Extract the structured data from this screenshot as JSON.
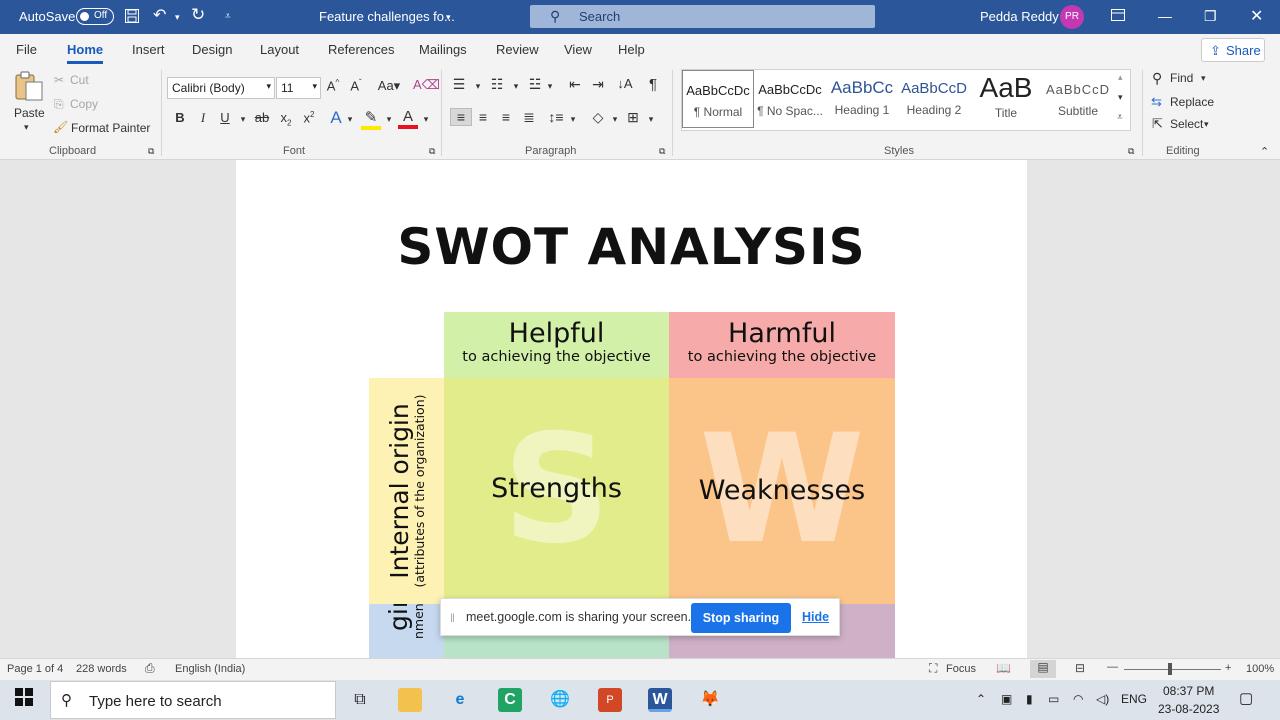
{
  "titlebar": {
    "autosave_label": "AutoSave",
    "autosave_state": "Off",
    "doc_title": "Feature challenges fo...",
    "search_placeholder": "Search",
    "user_name": "Pedda Reddy",
    "user_initials": "PR"
  },
  "menu": {
    "tabs": [
      "File",
      "Home",
      "Insert",
      "Design",
      "Layout",
      "References",
      "Mailings",
      "Review",
      "View",
      "Help"
    ],
    "active": "Home",
    "share_label": "Share"
  },
  "ribbon": {
    "clipboard": {
      "paste": "Paste",
      "cut": "Cut",
      "copy": "Copy",
      "format_painter": "Format Painter",
      "label": "Clipboard"
    },
    "font": {
      "name": "Calibri (Body)",
      "size": "11",
      "label": "Font"
    },
    "paragraph": {
      "label": "Paragraph"
    },
    "styles": {
      "items": [
        {
          "preview": "AaBbCcDc",
          "name": "¶ Normal"
        },
        {
          "preview": "AaBbCcDc",
          "name": "¶ No Spac..."
        },
        {
          "preview": "AaBbCc",
          "name": "Heading 1"
        },
        {
          "preview": "AaBbCcD",
          "name": "Heading 2"
        },
        {
          "preview": "AaB",
          "name": "Title"
        },
        {
          "preview": "AaBbCcD",
          "name": "Subtitle"
        }
      ],
      "label": "Styles"
    },
    "editing": {
      "find": "Find",
      "replace": "Replace",
      "select": "Select",
      "label": "Editing"
    }
  },
  "document": {
    "title": "SWOT ANALYSIS",
    "helpful": "Helpful",
    "helpful_sub": "to achieving the objective",
    "harmful": "Harmful",
    "harmful_sub": "to achieving the objective",
    "internal": "Internal origin",
    "internal_sub": "(attributes of the organization)",
    "external_partial": "gin",
    "external_sub_partial": "nment)",
    "strengths": "Strengths",
    "weaknesses": "Weaknesses",
    "s_letter": "S",
    "w_letter": "W"
  },
  "share_banner": {
    "message": "meet.google.com is sharing your screen.",
    "stop": "Stop sharing",
    "hide": "Hide"
  },
  "statusbar": {
    "page": "Page 1 of 4",
    "words": "228 words",
    "language": "English (India)",
    "focus": "Focus",
    "zoom": "100%"
  },
  "taskbar": {
    "search_placeholder": "Type here to search",
    "lang": "ENG",
    "time": "08:37 PM",
    "date": "23-08-2023"
  },
  "colors": {
    "word_blue": "#2b579a",
    "helpful_green": "#d3f0a8",
    "harmful_red": "#f7aaaa",
    "strengths": "#e3ec8b",
    "weaknesses": "#fbc58a",
    "internal_yellow": "#fdf2b3",
    "external_blue": "#c6d9ef",
    "opp_green": "#b9e3c9",
    "threat_purple": "#cfb1c7",
    "meet_blue": "#1a73e8"
  }
}
